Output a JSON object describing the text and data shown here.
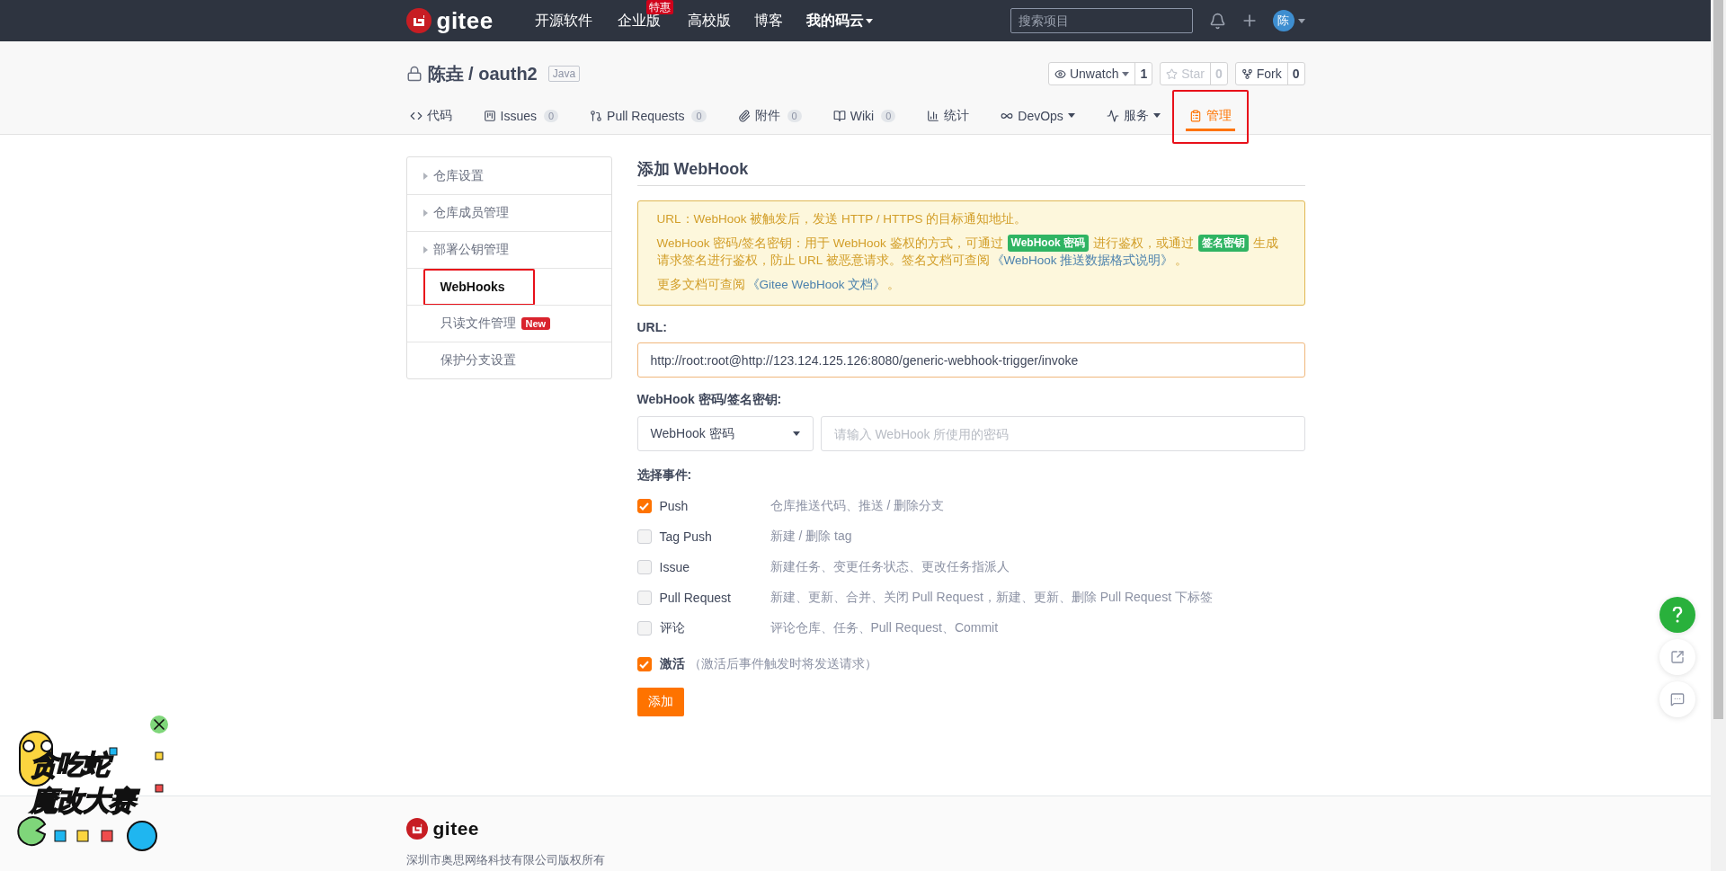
{
  "top_nav": {
    "brand": "gitee",
    "links": [
      {
        "label": "开源软件",
        "dropdown": false
      },
      {
        "label": "企业版",
        "badge": "特惠",
        "dropdown": false
      },
      {
        "label": "高校版",
        "dropdown": false
      },
      {
        "label": "博客",
        "dropdown": false
      },
      {
        "label": "我的码云",
        "dropdown": true
      }
    ],
    "search": {
      "placeholder": "搜索项目"
    },
    "avatar": "陈"
  },
  "repo": {
    "owner": "陈垚",
    "separator": "/",
    "name": "oauth2",
    "language": "Java",
    "private": true,
    "actions": [
      {
        "label": "Unwatch",
        "count": "1",
        "dropdown": true,
        "disabled": false
      },
      {
        "label": "Star",
        "count": "0",
        "dropdown": false,
        "disabled": true
      },
      {
        "label": "Fork",
        "count": "0",
        "dropdown": false,
        "disabled": false
      }
    ],
    "tabs": [
      {
        "label": "代码",
        "selected": false,
        "highlighted": false
      },
      {
        "label": "Issues",
        "count": "0",
        "selected": false,
        "highlighted": false
      },
      {
        "label": "Pull Requests",
        "count": "0",
        "selected": false,
        "highlighted": false
      },
      {
        "label": "附件",
        "count": "0",
        "selected": false,
        "highlighted": false
      },
      {
        "label": "Wiki",
        "count": "0",
        "selected": false,
        "highlighted": false
      },
      {
        "label": "统计",
        "selected": false,
        "highlighted": false
      },
      {
        "label": "DevOps",
        "dropdown": true,
        "selected": false,
        "highlighted": false
      },
      {
        "label": "服务",
        "dropdown": true,
        "selected": false,
        "highlighted": false
      },
      {
        "label": "管理",
        "selected": true,
        "highlighted": true
      }
    ]
  },
  "sidebar": {
    "items": [
      {
        "label": "仓库设置",
        "expandable": true,
        "selected": false,
        "highlighted": false
      },
      {
        "label": "仓库成员管理",
        "expandable": true,
        "selected": false,
        "highlighted": false
      },
      {
        "label": "部署公钥管理",
        "expandable": true,
        "selected": false,
        "highlighted": false
      },
      {
        "label": "WebHooks",
        "expandable": false,
        "selected": true,
        "highlighted": true
      },
      {
        "label": "只读文件管理",
        "expandable": false,
        "selected": false,
        "highlighted": false,
        "badge": "New"
      },
      {
        "label": "保护分支设置",
        "expandable": false,
        "selected": false,
        "highlighted": false
      }
    ]
  },
  "form": {
    "title": "添加 WebHook",
    "notice": [
      [
        [
          {
            "kind": "text",
            "text": "URL：WebHook 被触发后，发送 HTTP / HTTPS 的目标通知地址。"
          }
        ]
      ],
      [
        [
          {
            "kind": "text",
            "text": "WebHook 密码/签名密钥：用于 WebHook 鉴权的方式，可通过"
          },
          {
            "kind": "tag",
            "text": "WebHook 密码"
          },
          {
            "kind": "text",
            "text": "进行鉴权，或通过"
          },
          {
            "kind": "tag",
            "text": "签名密钥"
          },
          {
            "kind": "text",
            "text": "生成"
          }
        ],
        [
          {
            "kind": "text",
            "text": "请求签名进行鉴权，防止 URL 被恶意请求。签名文档可查阅"
          },
          {
            "kind": "link",
            "text": "《WebHook 推送数据格式说明》"
          },
          {
            "kind": "text",
            "text": "。"
          }
        ]
      ],
      [
        [
          {
            "kind": "text",
            "text": "更多文档可查阅"
          },
          {
            "kind": "link",
            "text": "《Gitee WebHook 文档》"
          },
          {
            "kind": "text",
            "text": "。"
          }
        ]
      ]
    ],
    "url": {
      "label": "URL:",
      "value": "http://root:root@http://123.124.125.126:8080/generic-webhook-trigger/invoke"
    },
    "secret": {
      "label": "WebHook 密码/签名密钥:",
      "mode": "WebHook 密码",
      "placeholder": "请输入 WebHook 所使用的密码"
    },
    "events_label": "选择事件:",
    "events": [
      {
        "label": "Push",
        "description": "仓库推送代码、推送 / 删除分支",
        "checked": true
      },
      {
        "label": "Tag Push",
        "description": "新建 / 删除 tag",
        "checked": false
      },
      {
        "label": "Issue",
        "description": "新建任务、变更任务状态、更改任务指派人",
        "checked": false
      },
      {
        "label": "Pull Request",
        "description": "新建、更新、合并、关闭 Pull Request，新建、更新、删除 Pull Request 下标签",
        "checked": false
      },
      {
        "label": "评论",
        "description": "评论仓库、任务、Pull Request、Commit",
        "checked": false
      }
    ],
    "activate": {
      "label": "激活",
      "hint": "（激活后事件触发时将发送请求）",
      "checked": true
    },
    "submit": "添加"
  },
  "promo": {
    "lines": [
      "贪吃蛇",
      "魔改大赛"
    ]
  },
  "footer": {
    "brand": "gitee",
    "copyright": "深圳市奥思网络科技有限公司版权所有"
  }
}
